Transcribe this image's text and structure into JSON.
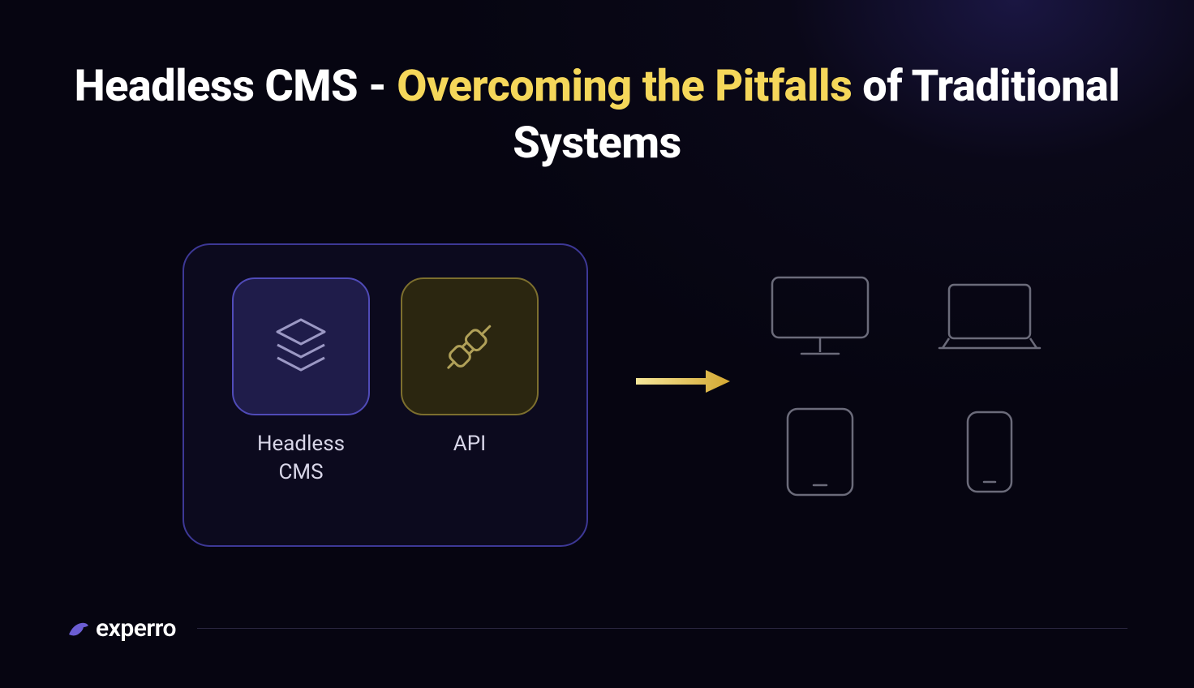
{
  "heading": {
    "part1": "Headless CMS - ",
    "highlight": "Overcoming the Pitfalls",
    "part2": " of Traditional Systems"
  },
  "card": {
    "tiles": [
      {
        "id": "headless-cms",
        "label_line1": "Headless",
        "label_line2": "CMS",
        "icon": "layers-icon",
        "variant": "purple"
      },
      {
        "id": "api",
        "label_line1": "API",
        "label_line2": "",
        "icon": "plug-icon",
        "variant": "gold"
      }
    ]
  },
  "arrow": {
    "color_start": "#f5e79a",
    "color_end": "#d4a832"
  },
  "devices": [
    {
      "id": "desktop",
      "icon": "monitor-icon"
    },
    {
      "id": "laptop",
      "icon": "laptop-icon"
    },
    {
      "id": "tablet",
      "icon": "tablet-icon"
    },
    {
      "id": "phone",
      "icon": "phone-icon"
    }
  ],
  "brand": {
    "name": "experro"
  },
  "colors": {
    "accent_purple": "#504bb8",
    "accent_gold": "#f5d75a",
    "device_stroke": "#6b6b7a"
  }
}
